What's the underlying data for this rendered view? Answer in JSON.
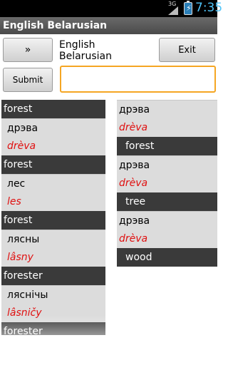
{
  "status_bar": {
    "network": "3G",
    "time": "7:35"
  },
  "title": "English Belarusian",
  "controls": {
    "swap_label": "»",
    "language_pair": "English Belarusian",
    "exit_label": "Exit",
    "submit_label": "Submit",
    "search_value": ""
  },
  "left_list": [
    {
      "kind": "head",
      "text": "forest"
    },
    {
      "kind": "native",
      "text": "дрэва"
    },
    {
      "kind": "translit",
      "text": "drèva"
    },
    {
      "kind": "head",
      "text": "forest"
    },
    {
      "kind": "native",
      "text": "лес"
    },
    {
      "kind": "translit",
      "text": "les"
    },
    {
      "kind": "head",
      "text": "forest"
    },
    {
      "kind": "native",
      "text": "лясны"
    },
    {
      "kind": "translit",
      "text": "lâsny"
    },
    {
      "kind": "head",
      "text": "forester"
    },
    {
      "kind": "native",
      "text": "ляснічы"
    },
    {
      "kind": "translit",
      "text": "lâsničy"
    },
    {
      "kind": "head",
      "text": "forester"
    }
  ],
  "right_list": [
    {
      "kind": "native",
      "text": "дрэва"
    },
    {
      "kind": "translit",
      "text": "drèva"
    },
    {
      "kind": "result",
      "text": "forest"
    },
    {
      "kind": "native",
      "text": "дрэва"
    },
    {
      "kind": "translit",
      "text": "drèva"
    },
    {
      "kind": "result",
      "text": "tree"
    },
    {
      "kind": "native",
      "text": "дрэва"
    },
    {
      "kind": "translit",
      "text": "drèva"
    },
    {
      "kind": "result",
      "text": "wood"
    }
  ]
}
